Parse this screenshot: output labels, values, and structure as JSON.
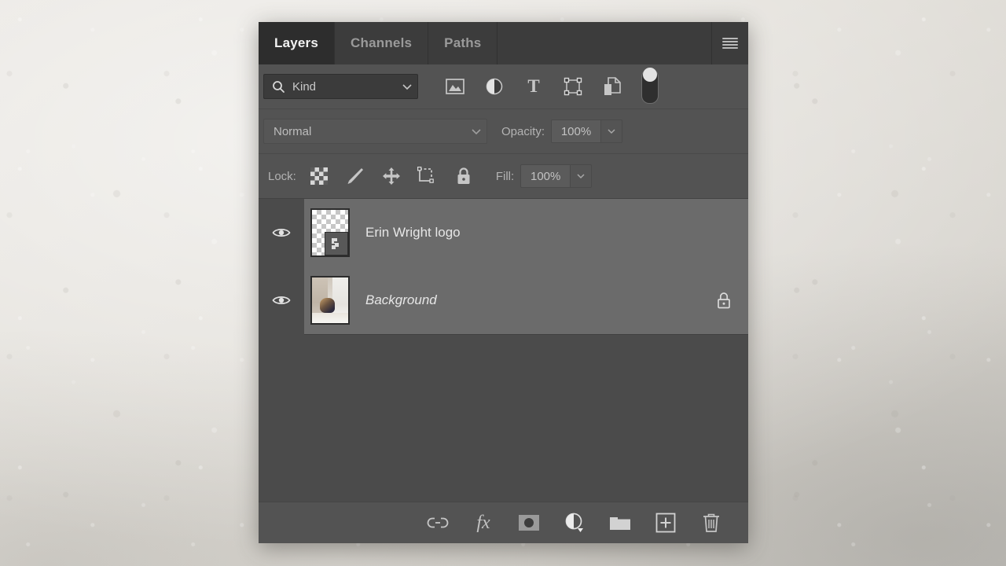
{
  "panel": {
    "title": "Layers",
    "tabs": [
      {
        "label": "Layers",
        "active": true
      },
      {
        "label": "Channels",
        "active": false
      },
      {
        "label": "Paths",
        "active": false
      }
    ],
    "menu_icon": "hamburger-menu-icon"
  },
  "filter_bar": {
    "search_icon": "search-icon",
    "kind_value": "Kind",
    "chevron_icon": "chevron-down-icon",
    "filter_types": [
      {
        "name": "pixel-layer-filter",
        "icon": "image-icon",
        "label": "Pixel"
      },
      {
        "name": "adjustment-layer-filter",
        "icon": "half-circle-icon",
        "label": "Adjustment"
      },
      {
        "name": "type-layer-filter",
        "icon": "text-t-icon",
        "label": "T"
      },
      {
        "name": "shape-layer-filter",
        "icon": "shape-bounding-box-icon",
        "label": "Shape"
      },
      {
        "name": "smart-object-filter",
        "icon": "smart-object-icon",
        "label": "Smart Object"
      }
    ],
    "toggle": {
      "name": "filter-enable-toggle",
      "state": "on"
    }
  },
  "blend_bar": {
    "mode_value": "Normal",
    "mode_chevron": "chevron-down-icon",
    "opacity_label": "Opacity:",
    "opacity_value": "100%",
    "opacity_chevron": "chevron-down-icon"
  },
  "lock_bar": {
    "label": "Lock:",
    "items": [
      {
        "name": "lock-transparent-pixels",
        "icon": "checkerboard-icon"
      },
      {
        "name": "lock-image-pixels",
        "icon": "brush-icon"
      },
      {
        "name": "lock-position",
        "icon": "move-arrows-icon"
      },
      {
        "name": "lock-artboard-nesting",
        "icon": "artboard-icon"
      },
      {
        "name": "lock-all",
        "icon": "padlock-icon"
      }
    ],
    "fill_label": "Fill:",
    "fill_value": "100%",
    "fill_chevron": "chevron-down-icon"
  },
  "layers": [
    {
      "name": "Erin Wright logo",
      "visible": true,
      "selected": true,
      "italic": false,
      "locked": false,
      "thumbnail": "transparent-checkerboard-with-logo"
    },
    {
      "name": "Background",
      "visible": true,
      "selected": true,
      "italic": true,
      "locked": true,
      "thumbnail": "photo-interior-scene"
    }
  ],
  "bottom_bar": {
    "buttons": [
      {
        "name": "link-layers-button",
        "icon": "chain-link-icon",
        "label": "Link layers"
      },
      {
        "name": "layer-style-button",
        "icon": "fx-icon",
        "label": "fx"
      },
      {
        "name": "add-layer-mask-button",
        "icon": "mask-icon",
        "label": "Add layer mask"
      },
      {
        "name": "new-adjustment-layer-button",
        "icon": "half-circle-icon",
        "label": "New adjustment layer"
      },
      {
        "name": "new-group-button",
        "icon": "folder-icon",
        "label": "New group"
      },
      {
        "name": "new-layer-button",
        "icon": "plus-square-icon",
        "label": "New layer"
      },
      {
        "name": "delete-layer-button",
        "icon": "trash-icon",
        "label": "Delete layer"
      }
    ]
  },
  "colors": {
    "panel_bg": "#535353",
    "tab_inactive": "#3c3c3c",
    "tab_active": "#2d2d2d",
    "list_bg": "#4b4b4b",
    "row_selected": "#6b6b6b",
    "text_primary": "#e6e6e6",
    "text_muted": "#b3b3b3",
    "desktop_bg": "#e2dfd9"
  }
}
